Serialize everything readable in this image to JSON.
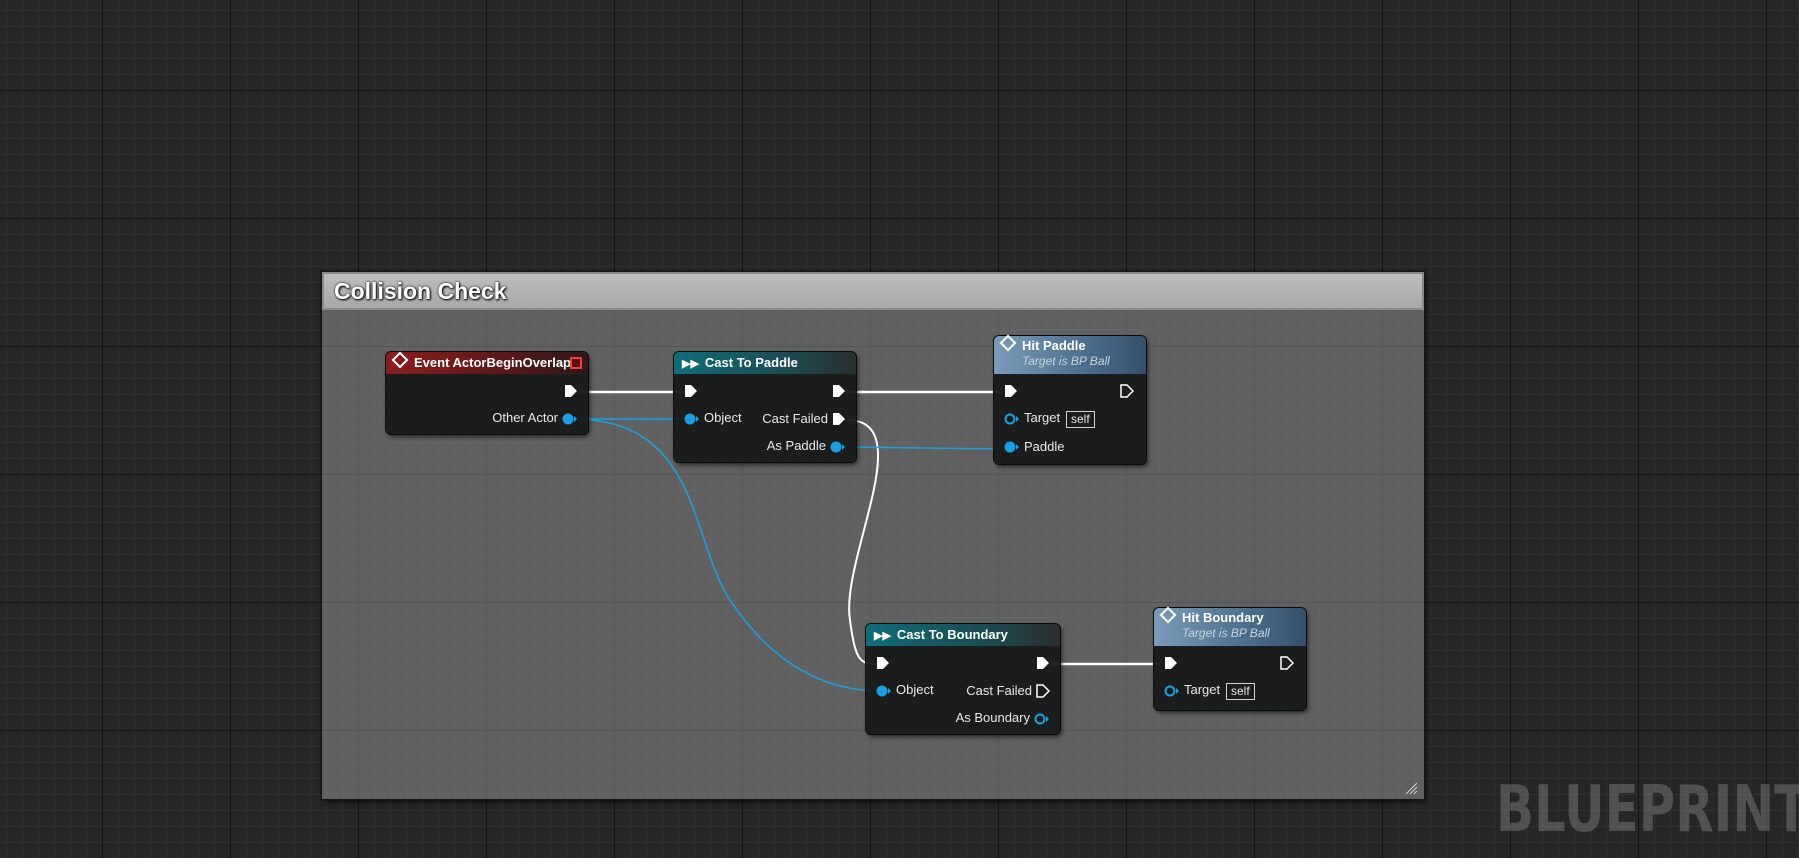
{
  "comment": {
    "title": "Collision Check"
  },
  "nodes": {
    "event_begin_overlap": {
      "title": "Event ActorBeginOverlap",
      "pins": {
        "other_actor": "Other Actor"
      }
    },
    "cast_to_paddle": {
      "title": "Cast To Paddle",
      "pins": {
        "object": "Object",
        "cast_failed": "Cast Failed",
        "as_paddle": "As Paddle"
      }
    },
    "hit_paddle": {
      "title": "Hit Paddle",
      "subtitle": "Target is BP Ball",
      "pins": {
        "target": "Target",
        "target_default": "self",
        "paddle": "Paddle"
      }
    },
    "cast_to_boundary": {
      "title": "Cast To Boundary",
      "pins": {
        "object": "Object",
        "cast_failed": "Cast Failed",
        "as_boundary": "As Boundary"
      }
    },
    "hit_boundary": {
      "title": "Hit Boundary",
      "subtitle": "Target is BP Ball",
      "pins": {
        "target": "Target",
        "target_default": "self"
      }
    }
  },
  "watermark": "BLUEPRINT",
  "colors": {
    "background": "#262626",
    "object_pin": "#1aa0e0",
    "exec_wire": "#ffffff",
    "event_header": "#8a1d1f",
    "cast_header": "#0f6e78",
    "function_header": "#7b9cb8"
  }
}
